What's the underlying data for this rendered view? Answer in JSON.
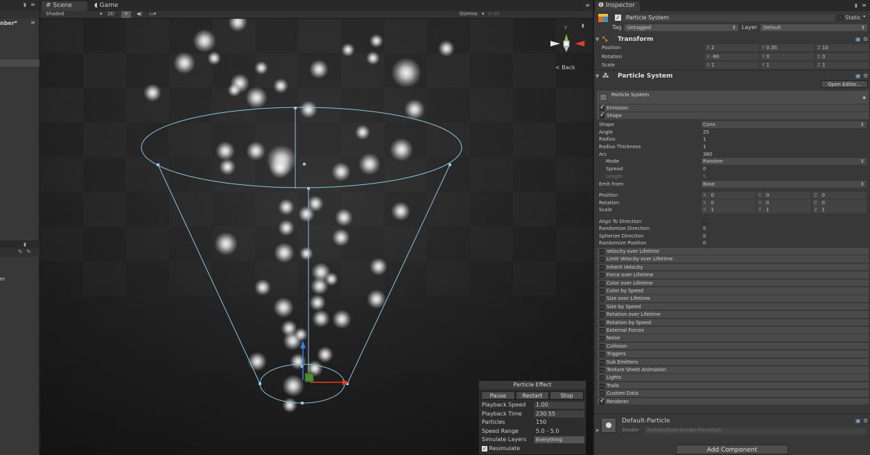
{
  "left_panel": {
    "title_fragment": "nber*",
    "lower_fragment": "er"
  },
  "scene": {
    "tabs": [
      "Scene",
      "Game"
    ],
    "toolbar": {
      "shading": "Shaded",
      "mode_2d": "2D",
      "gizmos": "Gizmos",
      "search_placeholder": "G·All"
    },
    "gizmo_label": "Back"
  },
  "particle_effect": {
    "title": "Particle Effect",
    "buttons": [
      "Pause",
      "Restart",
      "Stop"
    ],
    "rows": [
      {
        "label": "Playback Speed",
        "value": "1.00"
      },
      {
        "label": "Playback Time",
        "value": "230.55"
      },
      {
        "label": "Particles",
        "value": "150"
      },
      {
        "label": "Speed Range",
        "value": "5.0 - 5.0"
      },
      {
        "label": "Simulate Layers",
        "value": "Everything"
      }
    ],
    "resimulate": "Resimulate"
  },
  "inspector": {
    "tab": "Inspector",
    "object_name": "Particle System",
    "static_label": "Static",
    "tag_label": "Tag",
    "tag_value": "Untagged",
    "layer_label": "Layer",
    "layer_value": "Default",
    "transform": {
      "title": "Transform",
      "rows": [
        {
          "label": "Position",
          "x": "2",
          "y": "0.35",
          "z": "10"
        },
        {
          "label": "Rotation",
          "x": "-90",
          "y": "0",
          "z": "0"
        },
        {
          "label": "Scale",
          "x": "1",
          "y": "1",
          "z": "1"
        }
      ]
    },
    "particle_system": {
      "title": "Particle System",
      "open_editor": "Open Editor...",
      "main_module": "Particle System",
      "emission": "Emission",
      "shape_module": "Shape",
      "shape_rows": [
        {
          "label": "Shape",
          "value": "Cone"
        },
        {
          "label": "Angle",
          "value": "25"
        },
        {
          "label": "Radius",
          "value": "1"
        },
        {
          "label": "Radius Thickness",
          "value": "1"
        },
        {
          "label": "Arc",
          "value": "360"
        },
        {
          "label": "Mode",
          "value": "Random"
        },
        {
          "label": "Spread",
          "value": "0"
        },
        {
          "label": "Length",
          "value": "5"
        },
        {
          "label": "Emit from:",
          "value": "Base"
        }
      ],
      "shape_transform": [
        {
          "label": "Position",
          "x": "0",
          "y": "0",
          "z": "0"
        },
        {
          "label": "Rotation",
          "x": "0",
          "y": "0",
          "z": "0"
        },
        {
          "label": "Scale",
          "x": "1",
          "y": "1",
          "z": "1"
        }
      ],
      "shape_options": [
        {
          "label": "Align To Direction",
          "value": ""
        },
        {
          "label": "Randomize Direction",
          "value": "0"
        },
        {
          "label": "Spherize Direction",
          "value": "0"
        },
        {
          "label": "Randomize Position",
          "value": "0"
        }
      ],
      "modules": [
        {
          "label": "Velocity over Lifetime",
          "on": false
        },
        {
          "label": "Limit Velocity over Lifetime",
          "on": false
        },
        {
          "label": "Inherit Velocity",
          "on": false
        },
        {
          "label": "Force over Lifetime",
          "on": false
        },
        {
          "label": "Color over Lifetime",
          "on": false
        },
        {
          "label": "Color by Speed",
          "on": false
        },
        {
          "label": "Size over Lifetime",
          "on": false
        },
        {
          "label": "Size by Speed",
          "on": false
        },
        {
          "label": "Rotation over Lifetime",
          "on": false
        },
        {
          "label": "Rotation by Speed",
          "on": false
        },
        {
          "label": "External Forces",
          "on": false
        },
        {
          "label": "Noise",
          "on": false
        },
        {
          "label": "Collision",
          "on": false
        },
        {
          "label": "Triggers",
          "on": false
        },
        {
          "label": "Sub Emitters",
          "on": false
        },
        {
          "label": "Texture Sheet Animation",
          "on": false
        },
        {
          "label": "Lights",
          "on": false
        },
        {
          "label": "Trails",
          "on": false
        },
        {
          "label": "Custom Data",
          "on": false
        },
        {
          "label": "Renderer",
          "on": true
        }
      ]
    },
    "material": {
      "name": "Default-Particle",
      "shader_label": "Shader",
      "shader_value": "Particles/Alpha Blended Premultiply"
    },
    "add_component": "Add Component"
  },
  "colors": {
    "accent": "#88c7e0",
    "background": "#383838",
    "axis_x": "#e04020",
    "axis_y": "#7fd020",
    "axis_z": "#3a7fe0"
  }
}
